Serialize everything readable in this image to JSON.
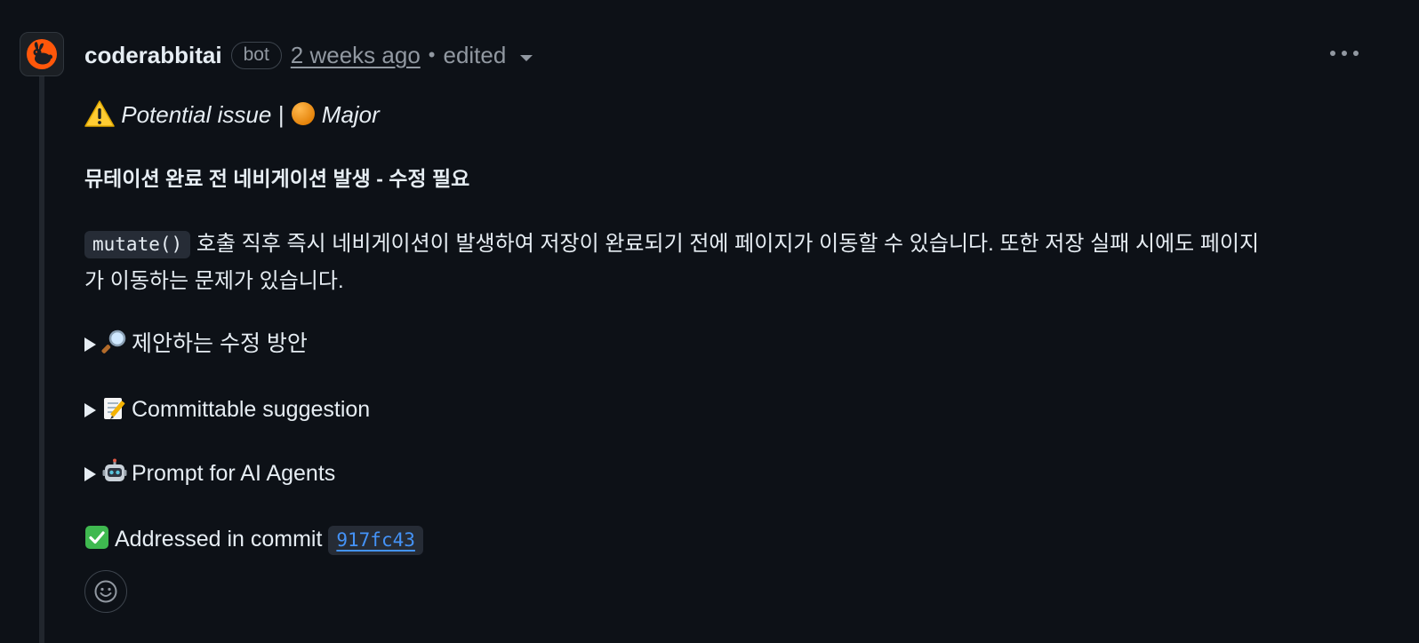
{
  "comment": {
    "author": "coderabbitai",
    "badge": "bot",
    "timestamp": "2 weeks ago",
    "separator": "•",
    "edited_label": "edited",
    "severity": {
      "label": "Potential issue | ",
      "level": "Major",
      "warning_icon": "warning-sign-emoji",
      "level_icon": "orange-circle-emoji"
    },
    "heading": "뮤테이션 완료 전 네비게이션 발생 - 수정 필요",
    "paragraph": {
      "code": "mutate()",
      "line1": " 호출 직후 즉시 네비게이션이 발생하여 저장이 완료되기 전에 페이지가 이동할 수 있습니다. 또한 저장 실패 시에도 페이지",
      "line2": "가 이동하는 문제가 있습니다."
    },
    "details": [
      {
        "icon": "magnifier-emoji",
        "label": "제안하는 수정 방안"
      },
      {
        "icon": "memo-emoji",
        "label": "Committable suggestion"
      },
      {
        "icon": "robot-emoji",
        "label": "Prompt for AI Agents"
      }
    ],
    "addressed": {
      "icon": "check-mark-emoji",
      "label": "Addressed in commit ",
      "commit": "917fc43"
    }
  },
  "colors": {
    "background": "#0d1117",
    "text": "#e6edf3",
    "muted": "#9198a1",
    "link": "#4493f8",
    "avatar_orange": "#ff570a",
    "check_green": "#3fb950"
  }
}
